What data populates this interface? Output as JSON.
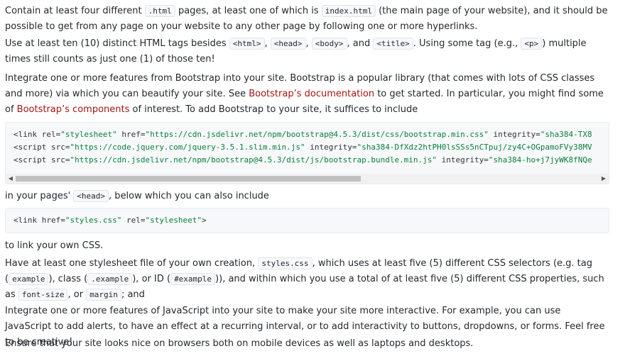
{
  "p1": {
    "a": "Contain at least four different ",
    "c1": ".html",
    "b": " pages, at least one of which is ",
    "c2": "index.html",
    "c": " (the main page of your website), and it should be possible to get from any page on your website to any other page by following one or more hyperlinks."
  },
  "p2": {
    "a": "Use at least ten (10) distinct HTML tags besides ",
    "c1": "<html>",
    "s1": ", ",
    "c2": "<head>",
    "s2": ", ",
    "c3": "<body>",
    "s3": ", and ",
    "c4": "<title>",
    "b": ". Using some tag (e.g., ",
    "c5": "<p>",
    "c": ") multiple times still counts as just one (1) of those ten!"
  },
  "p3": {
    "a": "Integrate one or more features from Bootstrap into your site. Bootstrap is a popular library (that comes with lots of CSS classes and more) via which you can beautify your site. See ",
    "link1": "Bootstrap’s documentation",
    "b": " to get started. In particular, you might find some of ",
    "link2": "Bootstrap’s components",
    "c": " of interest. To add Bootstrap to your site, it suffices to include"
  },
  "codeblock1": {
    "l1_tag": "<link rel=",
    "l1_v1": "\"stylesheet\"",
    "l1_a2": " href=",
    "l1_v2": "\"https://cdn.jsdelivr.net/npm/bootstrap@4.5.3/dist/css/bootstrap.min.css\"",
    "l1_a3": " integrity=",
    "l1_v3": "\"sha384-TX8",
    "l2_tag": "<script src=",
    "l2_v1": "\"https://code.jquery.com/jquery-3.5.1.slim.min.js\"",
    "l2_a2": " integrity=",
    "l2_v2": "\"sha384-DfXdz2htPH0lsSSs5nCTpuj/zy4C+OGpamoFVy38MV",
    "l3_tag": "<script src=",
    "l3_v1": "\"https://cdn.jsdelivr.net/npm/bootstrap@4.5.3/dist/js/bootstrap.bundle.min.js\"",
    "l3_a2": " integrity=",
    "l3_v2": "\"sha384-ho+j7jyWK8fNQe"
  },
  "p4": {
    "a": "in your pages' ",
    "c1": "<head>",
    "b": ", below which you can also include"
  },
  "codeblock2": {
    "tag": "<link href=",
    "v1": "\"styles.css\"",
    "a2": " rel=",
    "v2": "\"stylesheet\"",
    "end": ">"
  },
  "p5": {
    "a": "to link your own CSS."
  },
  "p6": {
    "a": "Have at least one stylesheet file of your own creation, ",
    "c1": "styles.css",
    "b": ", which uses at least five (5) different CSS selectors (e.g. tag (",
    "c2": "example",
    "c": "), class (",
    "c3": ".example",
    "d": "), or ID (",
    "c4": "#example",
    "e": ")), and within which you use a total of at least five (5) different CSS properties, such as ",
    "c5": "font-size",
    "f": ", or ",
    "c6": "margin",
    "g": "; and"
  },
  "p7": {
    "a": "Integrate one or more features of JavaScript into your site to make your site more interactive. For example, you can use JavaScript to add alerts, to have an effect at a recurring interval, or to add interactivity to buttons, dropdowns, or forms. Feel free to be creative!"
  },
  "p8": {
    "a": "Ensure that your site looks nice on browsers both on mobile devices as well as laptops and desktops."
  },
  "scroll": {
    "left_arrow": "◀",
    "right_arrow": "▶"
  },
  "colors": {
    "link": "#a31515",
    "string": "#0b7f3a",
    "code_bg": "#f6f8fa"
  }
}
